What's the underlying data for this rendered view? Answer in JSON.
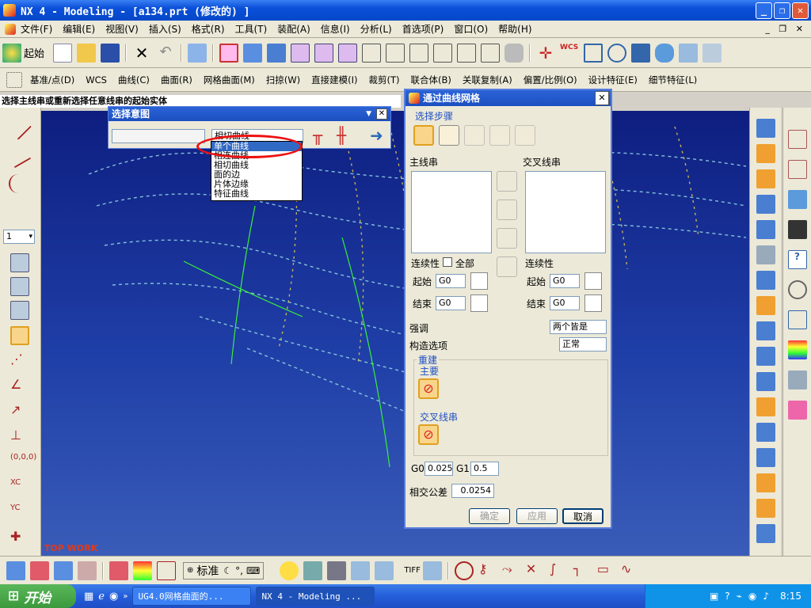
{
  "window": {
    "title": "NX 4 - Modeling - [a134.prt  (修改的) ]"
  },
  "menu": [
    "文件(F)",
    "编辑(E)",
    "视图(V)",
    "插入(S)",
    "格式(R)",
    "工具(T)",
    "装配(A)",
    "信息(I)",
    "分析(L)",
    "首选项(P)",
    "窗口(O)",
    "帮助(H)"
  ],
  "toolbar1": {
    "start_label": "起始"
  },
  "toolbar2": [
    "基准/点(D)",
    "WCS",
    "曲线(C)",
    "曲面(R)",
    "网格曲面(M)",
    "扫掠(W)",
    "直接建模(I)",
    "裁剪(T)",
    "联合体(B)",
    "关联复制(A)",
    "偏置/比例(O)",
    "设计特征(E)",
    "细节特征(L)"
  ],
  "status_line": "选择主线串或重新选择任意线串的起始实体",
  "viewport": {
    "label": "TOP WORK",
    "layer_value": "1"
  },
  "selection_intent": {
    "title": "选择意图",
    "combo_value": "相切曲线",
    "options": [
      "单个曲线",
      "相连曲线",
      "相切曲线",
      "面的边",
      "片体边缘",
      "特征曲线"
    ],
    "selected_index": 0
  },
  "dialog": {
    "title": "通过曲线网格",
    "step_group_label": "选择步骤",
    "primary_label": "主线串",
    "cross_label": "交叉线串",
    "continuity_label": "连续性",
    "all_label": "全部",
    "start_label": "起始",
    "end_label": "结束",
    "g0": "G0",
    "emphasis_label": "强调",
    "emphasis_value": "两个皆是",
    "construct_label": "构造选项",
    "construct_value": "正常",
    "rebuild_label": "重建",
    "main_label": "主要",
    "cross_rebuild_label": "交叉线串",
    "g0_label": "G0",
    "g0_value": "0.025",
    "g1_label": "G1",
    "g1_value": "0.5",
    "tolerance_label": "相交公差",
    "tolerance_value": "0.0254",
    "ok_label": "确定",
    "apply_label": "应用",
    "cancel_label": "取消"
  },
  "bottom_toolbar": {
    "ime_label": "标准"
  },
  "taskbar": {
    "start_label": "开始",
    "task1": "UG4.0网格曲面的...",
    "task2": "NX 4 - Modeling ...",
    "time": "8:15"
  }
}
